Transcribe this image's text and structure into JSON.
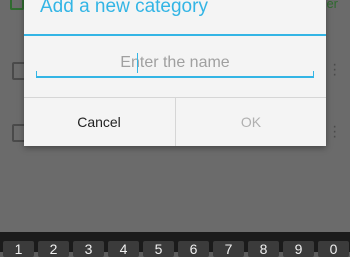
{
  "background": {
    "top_text": "er"
  },
  "dialog": {
    "title": "Add a new category",
    "input_placeholder": "Enter the name",
    "input_value": "",
    "cancel_label": "Cancel",
    "ok_label": "OK"
  },
  "keyboard": {
    "number_row": [
      "1",
      "2",
      "3",
      "4",
      "5",
      "6",
      "7",
      "8",
      "9",
      "0"
    ]
  },
  "colors": {
    "accent": "#33b5e5",
    "disabled_text": "#b0b0b0",
    "dim_overlay": "#6b6b6b"
  },
  "icons": [
    "file-icon",
    "more-vertical-icon"
  ]
}
